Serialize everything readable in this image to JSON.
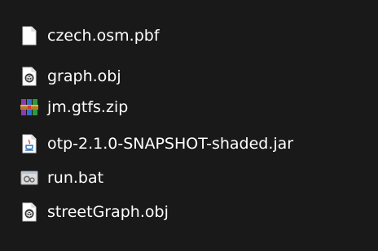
{
  "files": [
    {
      "name": "czech.osm.pbf",
      "icon": "blank-file-icon"
    },
    {
      "name": "graph.obj",
      "icon": "obj-file-icon"
    },
    {
      "name": "jm.gtfs.zip",
      "icon": "winrar-archive-icon"
    },
    {
      "name": "otp-2.1.0-SNAPSHOT-shaded.jar",
      "icon": "java-jar-icon"
    },
    {
      "name": "run.bat",
      "icon": "batch-file-icon"
    },
    {
      "name": "streetGraph.obj",
      "icon": "obj-file-icon"
    }
  ],
  "colors": {
    "background": "#191919",
    "text": "#ffffff"
  }
}
